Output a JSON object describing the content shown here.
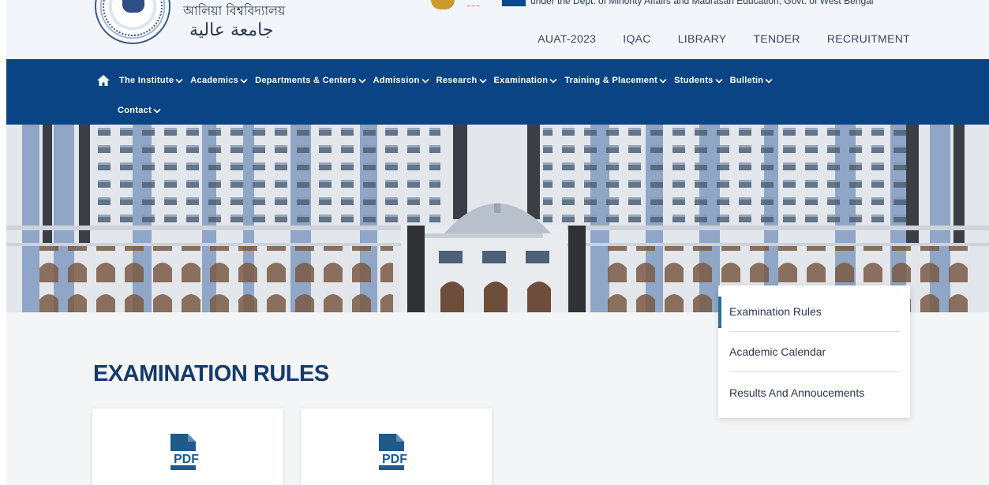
{
  "header": {
    "uni_name_bengali": "আলিয়া বিশ্ববিদ্যালয়",
    "uni_name_arabic": "جامعة عالية",
    "dept_notice": "under the Dept. of Minority Affairs and Madrasah Education, Govt. of West Bengal",
    "top_links": [
      "AUAT-2023",
      "IQAC",
      "LIBRARY",
      "TENDER",
      "RECRUITMENT"
    ]
  },
  "nav": {
    "items": [
      "The Institute",
      "Academics",
      "Departments & Centers",
      "Admission",
      "Research",
      "Examination",
      "Training & Placement",
      "Students",
      "Bulletin",
      "Contact"
    ]
  },
  "main": {
    "title": "EXAMINATION RULES",
    "cards": [
      {
        "icon": "pdf-icon",
        "icon_text": "PDF"
      },
      {
        "icon": "pdf-icon",
        "icon_text": "PDF"
      }
    ]
  },
  "side_menu": {
    "items": [
      "Examination Rules",
      "Academic Calendar",
      "Results And Annoucements"
    ],
    "active_index": 0
  },
  "colors": {
    "nav_bg": "#0a4484",
    "title": "#163a6b",
    "pdf_icon": "#1e5a8c",
    "active_bar": "#2e6f8f"
  }
}
